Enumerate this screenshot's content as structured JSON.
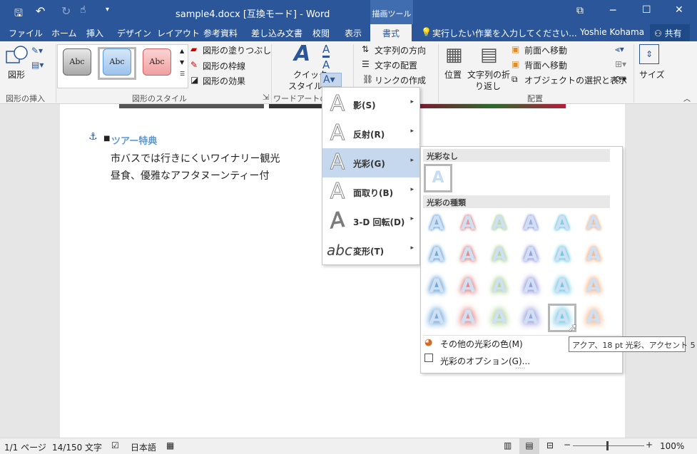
{
  "window": {
    "title": "sample4.docx [互換モード] - Word",
    "context_tab": "描画ツール",
    "controls": {
      "restore": "⧉",
      "minimize": "─",
      "maximize": "☐",
      "close": "✕"
    }
  },
  "tabs": [
    "ファイル",
    "ホーム",
    "挿入",
    "デザイン",
    "レイアウト",
    "参考資料",
    "差し込み文書",
    "校閲",
    "表示",
    "書式"
  ],
  "tell_me": "実行したい作業を入力してください...",
  "user": "Yoshie Kohama",
  "share": "共有",
  "ribbon": {
    "insert_shapes": {
      "shape_label": "図形",
      "group": "図形の挿入"
    },
    "shape_styles": {
      "abc": "Abc",
      "fill": "図形の塗りつぶし",
      "outline": "図形の枠線",
      "effects": "図形の効果",
      "group": "図形のスタイル"
    },
    "wordart": {
      "quick": "クイック",
      "style": "スタイル",
      "group": "ワードアートのス"
    },
    "text": {
      "direction": "文字列の方向",
      "align": "文字の配置",
      "link": "リンクの作成"
    },
    "arrange": {
      "position": "位置",
      "wrap1": "文字列の折",
      "wrap2": "り返し",
      "front": "前面へ移動",
      "back": "背面へ移動",
      "select": "オブジェクトの選択と表示",
      "group": "配置"
    },
    "size": {
      "label": "サイズ"
    }
  },
  "document": {
    "bullet_title": "ツアー特典",
    "line1": "市バスでは行きにくいワイナリー観光",
    "line2": "昼食、優雅なアフタヌーンティー付"
  },
  "effects_menu": [
    {
      "label": "影(S)",
      "icon": "shadow-icon"
    },
    {
      "label": "反射(R)",
      "icon": "reflection-icon"
    },
    {
      "label": "光彩(G)",
      "icon": "glow-icon",
      "selected": true
    },
    {
      "label": "面取り(B)",
      "icon": "bevel-icon"
    },
    {
      "label": "3-D 回転(D)",
      "icon": "rotation-3d-icon"
    },
    {
      "label": "変形(T)",
      "icon": "transform-icon"
    }
  ],
  "glow_gallery": {
    "no_glow_header": "光彩なし",
    "variations_header": "光彩の種類",
    "glyph": "A",
    "abc_glyph": "abc",
    "colors": [
      "#5b9bd5",
      "#e07b7b",
      "#a9d18e",
      "#8e8ed8",
      "#5bc0de",
      "#f4b183"
    ],
    "rows": 4,
    "selected": {
      "row": 3,
      "col": 4
    },
    "more_colors": "その他の光彩の色(M)",
    "options": "光彩のオプション(G)...",
    "grip": "....."
  },
  "tooltip": "アクア、18 pt 光彩、アクセント 5",
  "status": {
    "page": "1/1 ページ",
    "words": "14/150 文字",
    "lang": "日本語",
    "zoom": "100%"
  }
}
